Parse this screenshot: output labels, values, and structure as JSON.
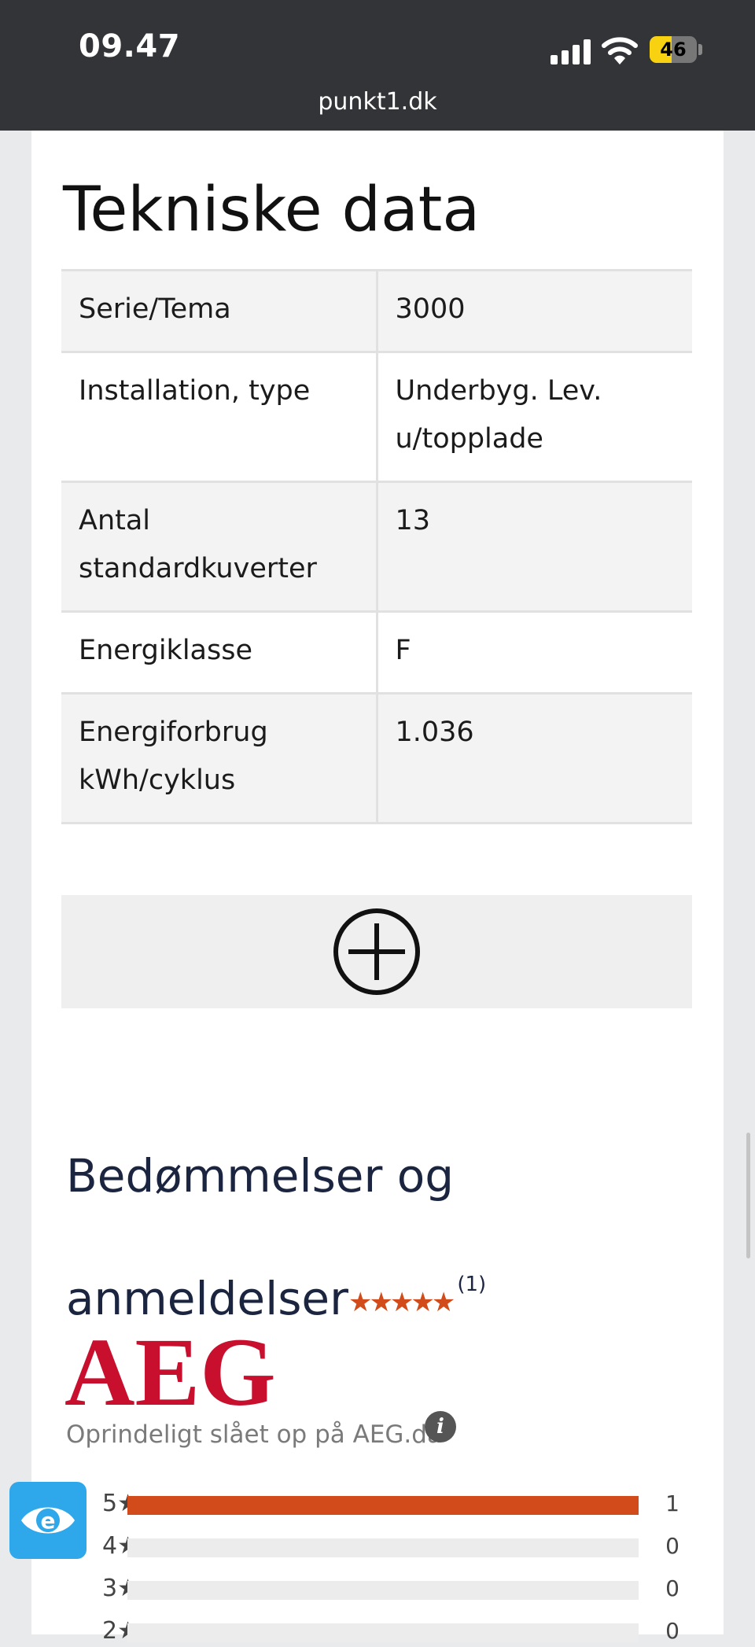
{
  "status_bar": {
    "time": "09.47",
    "battery_level": "46",
    "url": "punkt1.dk"
  },
  "tech": {
    "title": "Tekniske data",
    "rows": [
      {
        "label": "Serie/Tema",
        "value": "3000"
      },
      {
        "label": "Installation, type",
        "value": "Underbyg. Lev. u/topplade"
      },
      {
        "label": "Antal standardkuverter",
        "value": "13"
      },
      {
        "label": "Energiklasse",
        "value": "F"
      },
      {
        "label": "Energiforbrug kWh/cyklus",
        "value": "1.036"
      }
    ]
  },
  "reviews": {
    "title": "Bedømmelser og anmeldelser",
    "stars": "★★★★★",
    "count": "(1)",
    "brand": "AEG",
    "origin": "Oprindeligt slået op på AEG.da",
    "info_icon": "i",
    "distribution": [
      {
        "label": "5★",
        "count": "1",
        "fraction": 1.0
      },
      {
        "label": "4★",
        "count": "0",
        "fraction": 0
      },
      {
        "label": "3★",
        "count": "0",
        "fraction": 0
      },
      {
        "label": "2★",
        "count": "0",
        "fraction": 0
      }
    ]
  },
  "colors": {
    "accent": "#d24b1a",
    "aeg_red": "#c8102e",
    "status_bar": "#323437",
    "a11y_button": "#2ea8ea"
  },
  "icons": {
    "expand": "plus-circle-icon",
    "accessibility": "eye-icon"
  }
}
